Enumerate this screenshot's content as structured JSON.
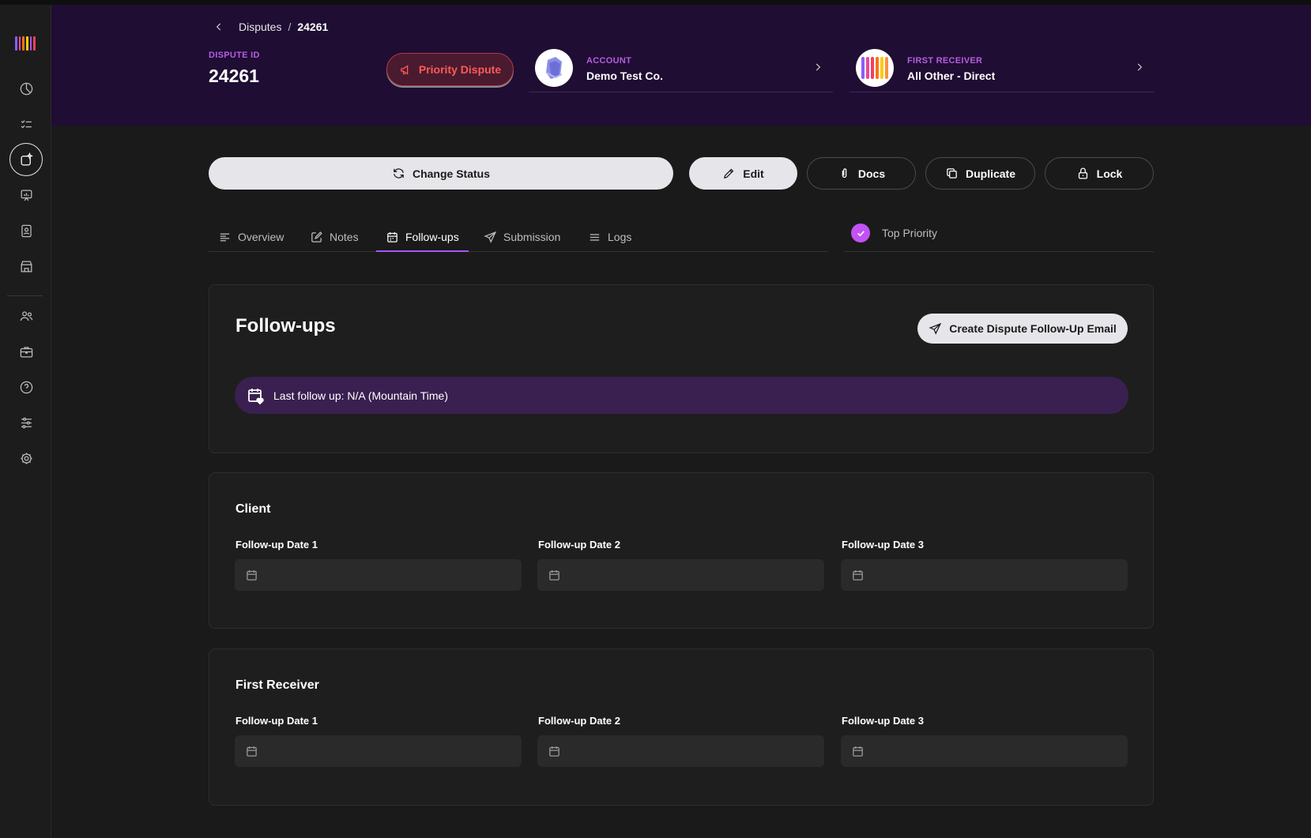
{
  "sidebar": {
    "logo_colors": [
      "#8b5cf6",
      "#ec4899",
      "#f97316",
      "#facc15",
      "#a855f7",
      "#f43f5e"
    ],
    "items": [
      {
        "icon": "chart-pie-icon"
      },
      {
        "icon": "checklist-icon"
      },
      {
        "icon": "disputes-icon",
        "active": true
      },
      {
        "icon": "presentation-chart-icon"
      },
      {
        "icon": "contact-card-icon"
      },
      {
        "icon": "store-icon"
      },
      {
        "icon": "users-icon"
      },
      {
        "icon": "briefcase-icon"
      },
      {
        "icon": "help-icon"
      },
      {
        "icon": "sliders-icon"
      },
      {
        "icon": "settings-icon"
      }
    ]
  },
  "breadcrumb": {
    "parent": "Disputes",
    "separator": "/",
    "current": "24261"
  },
  "dispute": {
    "id_label": "DISPUTE ID",
    "id_value": "24261"
  },
  "priority_button": "Priority Dispute",
  "account": {
    "label": "ACCOUNT",
    "value": "Demo Test Co."
  },
  "first_receiver": {
    "label": "FIRST RECEIVER",
    "value": "All Other - Direct"
  },
  "actions": {
    "change_status": "Change Status",
    "edit": "Edit",
    "docs": "Docs",
    "duplicate": "Duplicate",
    "lock": "Lock"
  },
  "tabs": [
    {
      "label": "Overview",
      "icon": "align-left-icon"
    },
    {
      "label": "Notes",
      "icon": "pencil-square-icon"
    },
    {
      "label": "Follow-ups",
      "icon": "calendar-icon",
      "active": true
    },
    {
      "label": "Submission",
      "icon": "send-icon"
    },
    {
      "label": "Logs",
      "icon": "menu-icon"
    }
  ],
  "top_priority": {
    "label": "Top Priority",
    "checked": true
  },
  "followups": {
    "title": "Follow-ups",
    "create_button": "Create Dispute Follow-Up Email",
    "last_followup": "Last follow up: N/A (Mountain Time)"
  },
  "client": {
    "title": "Client",
    "fields": [
      {
        "label": "Follow-up Date 1",
        "value": ""
      },
      {
        "label": "Follow-up Date 2",
        "value": ""
      },
      {
        "label": "Follow-up Date 3",
        "value": ""
      }
    ]
  },
  "receiver_section": {
    "title": "First Receiver",
    "fields": [
      {
        "label": "Follow-up Date 1",
        "value": ""
      },
      {
        "label": "Follow-up Date 2",
        "value": ""
      },
      {
        "label": "Follow-up Date 3",
        "value": ""
      }
    ]
  },
  "colors": {
    "accent": "#a855f7",
    "header_bg": "#1f0d33",
    "priority_text": "#ff5a5a",
    "label_purple": "#b45ee0",
    "check_bg": "#c252f5"
  }
}
